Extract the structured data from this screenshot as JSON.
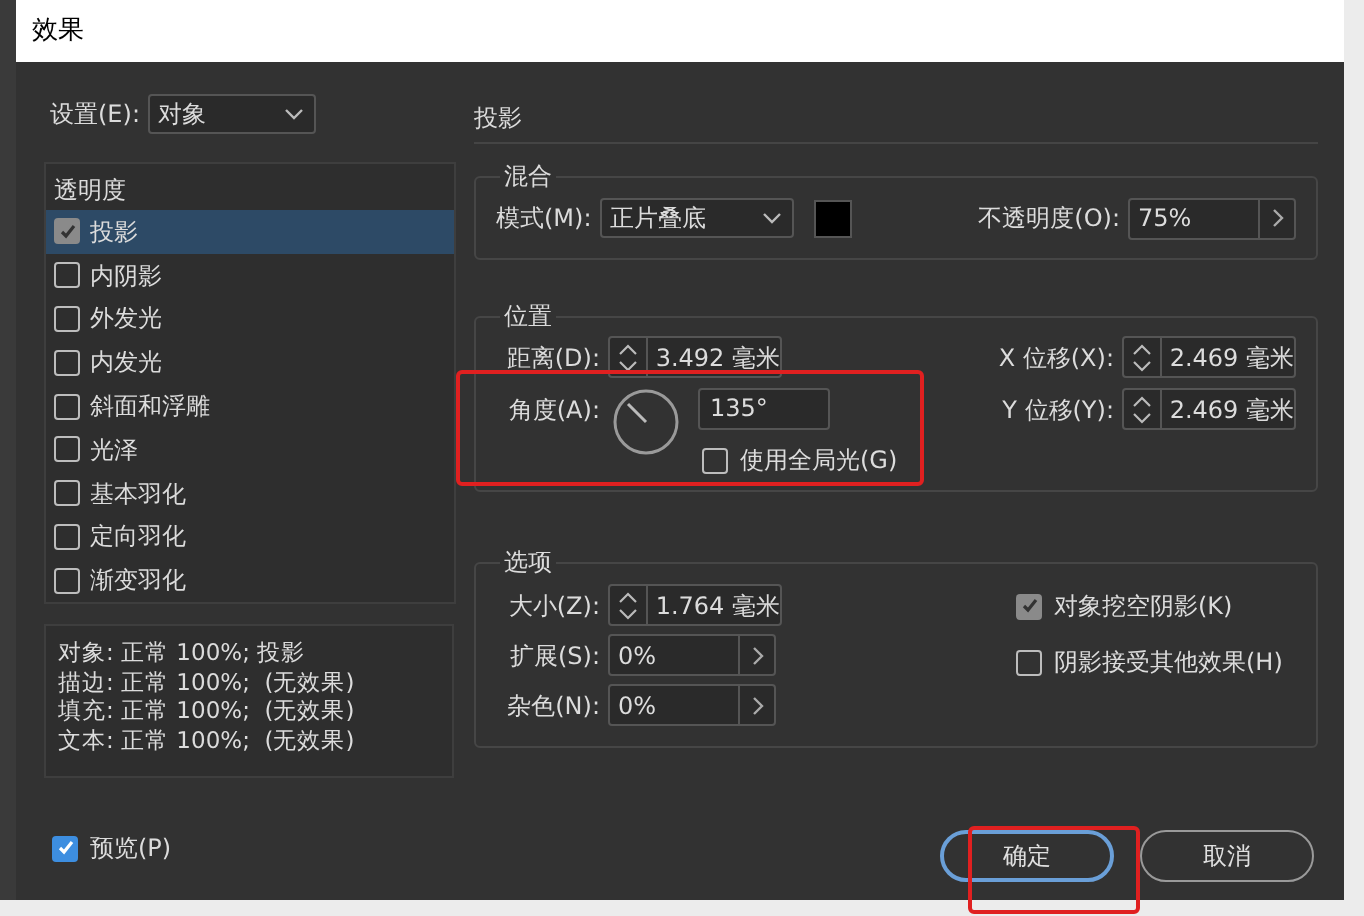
{
  "window": {
    "title": "效果"
  },
  "settings": {
    "label": "设置(E):",
    "value": "对象"
  },
  "effects": {
    "header": "透明度",
    "items": [
      {
        "label": "投影",
        "checked": true,
        "selected": true
      },
      {
        "label": "内阴影",
        "checked": false,
        "selected": false
      },
      {
        "label": "外发光",
        "checked": false,
        "selected": false
      },
      {
        "label": "内发光",
        "checked": false,
        "selected": false
      },
      {
        "label": "斜面和浮雕",
        "checked": false,
        "selected": false
      },
      {
        "label": "光泽",
        "checked": false,
        "selected": false
      },
      {
        "label": "基本羽化",
        "checked": false,
        "selected": false
      },
      {
        "label": "定向羽化",
        "checked": false,
        "selected": false
      },
      {
        "label": "渐变羽化",
        "checked": false,
        "selected": false
      }
    ]
  },
  "summary": [
    "对象: 正常 100%; 投影",
    "描边: 正常 100%;  (无效果)",
    "填充: 正常 100%;  (无效果)",
    "文本: 正常 100%;  (无效果)"
  ],
  "preview": {
    "label": "预览(P)",
    "checked": true
  },
  "section_title": "投影",
  "blend": {
    "title": "混合",
    "mode_label": "模式(M):",
    "mode": "正片叠底",
    "opacity_label": "不透明度(O):",
    "opacity": "75%"
  },
  "position": {
    "title": "位置",
    "distance_label": "距离(D):",
    "distance": "3.492 毫米",
    "angle_label": "角度(A):",
    "angle": "135°",
    "global_light": {
      "label": "使用全局光(G)",
      "checked": false
    },
    "x_label": "X 位移(X):",
    "x": "2.469 毫米",
    "y_label": "Y 位移(Y):",
    "y": "2.469 毫米",
    "highlighted": true
  },
  "options": {
    "title": "选项",
    "fields": [
      {
        "kind": "spinner",
        "label": "大小(Z):",
        "value": "1.764 毫米"
      },
      {
        "kind": "slider",
        "label": "扩展(S):",
        "value": "0%"
      },
      {
        "kind": "slider",
        "label": "杂色(N):",
        "value": "0%"
      }
    ],
    "checkboxes": [
      {
        "label": "对象挖空阴影(K)",
        "checked": true
      },
      {
        "label": "阴影接受其他效果(H)",
        "checked": false
      }
    ]
  },
  "buttons": [
    {
      "label": "确定",
      "default": true,
      "highlighted": true
    },
    {
      "label": "取消",
      "default": false,
      "highlighted": false
    }
  ]
}
